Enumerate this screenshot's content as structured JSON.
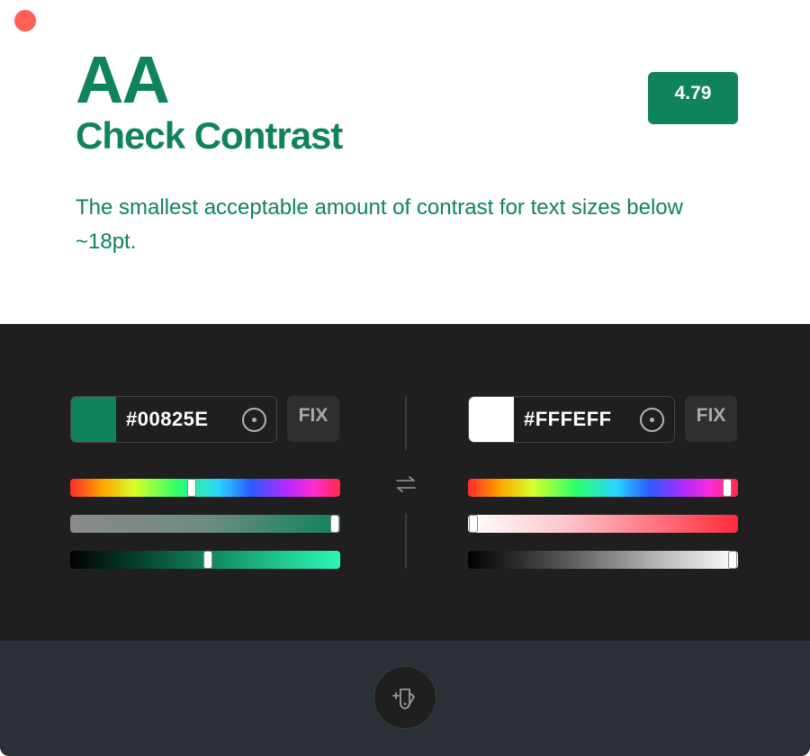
{
  "header": {
    "level": "AA",
    "title": "Check Contrast",
    "description": "The smallest acceptable amount of contrast for text sizes below ~18pt.",
    "ratio": "4.79"
  },
  "foreground": {
    "hex": "#00825E",
    "swatch_color": "#0f825e",
    "fix_label": "FIX",
    "hue_level": 0.45,
    "saturation_level": 0.98,
    "lightness_level": 0.51
  },
  "background": {
    "hex": "#FFFEFF",
    "swatch_color": "#ffffff",
    "fix_label": "FIX",
    "hue_level": 0.96,
    "saturation_level": 0.02,
    "lightness_level": 0.98
  },
  "icons": {
    "close": "close-icon",
    "swap": "swap-icon",
    "picker": "eyedropper-icon",
    "palette": "palette-icon"
  },
  "colors": {
    "accent": "#0f825e",
    "panel": "#1f1f1f",
    "footer": "#2b2f36",
    "close": "#ff5f57"
  }
}
